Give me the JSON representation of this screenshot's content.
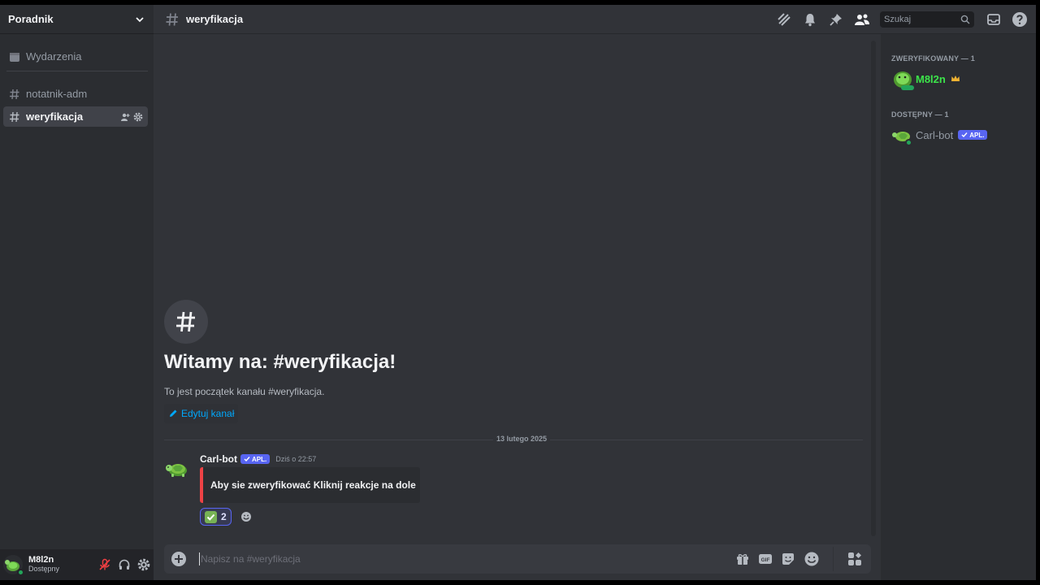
{
  "server": {
    "name": "Poradnik"
  },
  "sidebar": {
    "events_label": "Wydarzenia",
    "channels": [
      {
        "name": "notatnik-adm"
      },
      {
        "name": "weryfikacja"
      }
    ]
  },
  "user_panel": {
    "name": "M8l2n",
    "status": "Dostępny"
  },
  "topbar": {
    "channel": "weryfikacja",
    "search_placeholder": "Szukaj"
  },
  "welcome": {
    "title": "Witamy na: #weryfikacja!",
    "subtitle": "To jest początek kanału #weryfikacja.",
    "edit_label": "Edytuj kanał"
  },
  "date_divider": "13 lutego 2025",
  "message": {
    "author": "Carl-bot",
    "badge": "APL.",
    "time": "Dziś o 22:57",
    "embed_text": "Aby sie zweryfikować Kliknij reakcje na dole",
    "reaction_count": "2"
  },
  "composer": {
    "placeholder": "Napisz na #weryfikacja"
  },
  "members": {
    "groups": [
      {
        "label": "ZWERYFIKOWANY — 1",
        "members": [
          {
            "name": "M8l2n"
          }
        ]
      },
      {
        "label": "DOSTĘPNY — 1",
        "members": [
          {
            "name": "Carl-bot",
            "badge": "APL."
          }
        ]
      }
    ]
  },
  "colors": {
    "accent": "#5865f2",
    "online": "#23a55a",
    "embed_border": "#ed4245",
    "owner_name": "#3ce44a"
  }
}
